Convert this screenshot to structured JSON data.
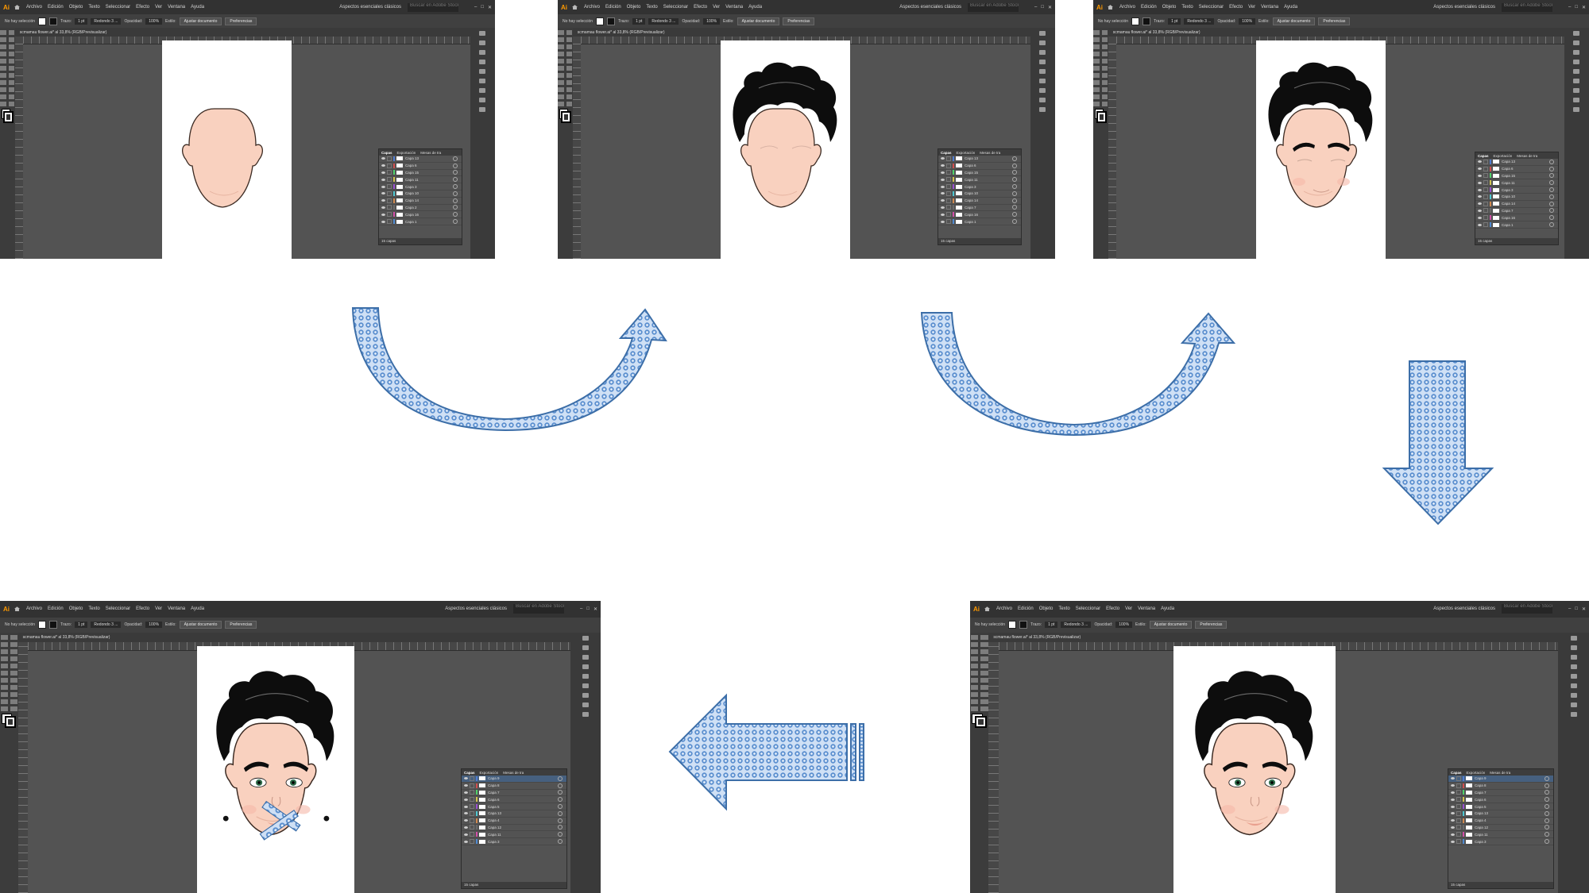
{
  "app": {
    "logo": "Ai",
    "menu": [
      "Archivo",
      "Edición",
      "Objeto",
      "Texto",
      "Seleccionar",
      "Efecto",
      "Ver",
      "Ventana",
      "Ayuda"
    ],
    "workspace": "Aspectos esenciales clásicos",
    "search_placeholder": "Buscar en Adobe Stock",
    "window_controls": [
      "–",
      "□",
      "✕"
    ]
  },
  "control_bar": {
    "selection": "No hay selección",
    "stroke_label": "Trazo:",
    "stroke_value": "1 pt",
    "brush": "Redondo 3 ...",
    "opacity_label": "Opacidad:",
    "opacity_value": "100%",
    "style_label": "Estilo:",
    "fit_doc_button": "Ajustar documento",
    "prefs_button": "Preferencias"
  },
  "document_tab": "scmamau flower.ai* al 33,8% (RGB/Previsualizar)",
  "layers_panel": {
    "tabs": [
      "Capas",
      "Exportación",
      "Mesas de tra"
    ],
    "footer": "15 capas"
  },
  "screens": [
    {
      "stage": "face",
      "layers": [
        "Capa 13",
        "Capa 6",
        "Capa 15",
        "Capa 11",
        "Capa 3",
        "Capa 10",
        "Capa 14",
        "Capa 2",
        "Capa 16",
        "Capa 1"
      ]
    },
    {
      "stage": "hair",
      "layers": [
        "Capa 13",
        "Capa 6",
        "Capa 15",
        "Capa 11",
        "Capa 3",
        "Capa 10",
        "Capa 14",
        "Capa 7",
        "Capa 16",
        "Capa 1"
      ]
    },
    {
      "stage": "brows",
      "layers": [
        "Capa 13",
        "Capa 6",
        "Capa 15",
        "Capa 11",
        "Capa 3",
        "Capa 10",
        "Capa 14",
        "Capa 7",
        "Capa 16",
        "Capa 1"
      ]
    },
    {
      "stage": "eyes",
      "layers": [
        "Capa 9",
        "Capa 8",
        "Capa 7",
        "Capa 6",
        "Capa 5",
        "Capa 13",
        "Capa 4",
        "Capa 12",
        "Capa 11",
        "Capa 3"
      ]
    },
    {
      "stage": "final",
      "layers": [
        "Capa 9",
        "Capa 8",
        "Capa 7",
        "Capa 6",
        "Capa 5",
        "Capa 13",
        "Capa 4",
        "Capa 12",
        "Capa 11",
        "Capa 3"
      ]
    }
  ],
  "colors": {
    "skin": "#f9d1bf",
    "skin_outline": "#3b2a22",
    "hair": "#0d0d0d",
    "arrow_fill": "#a7c6ec",
    "arrow_stroke": "#3c6ea8",
    "panel_bg": "#535353"
  }
}
